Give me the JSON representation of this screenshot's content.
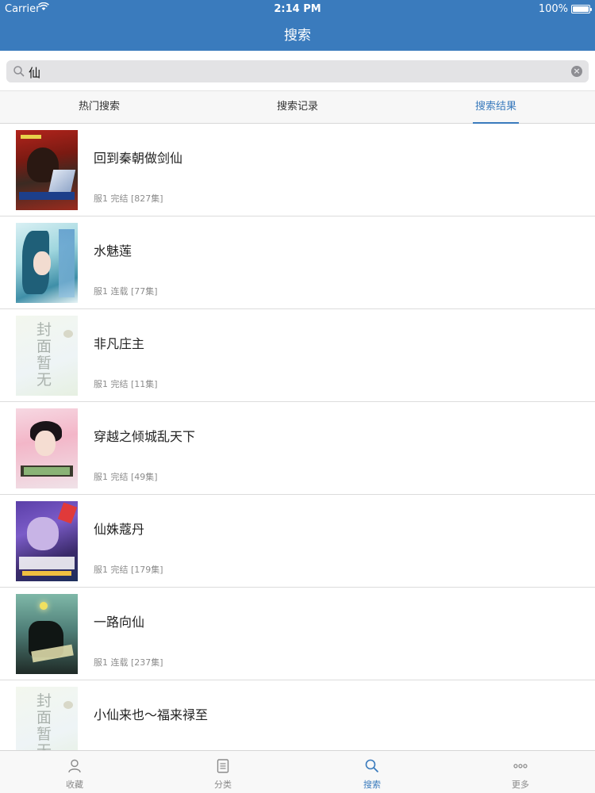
{
  "status": {
    "carrier": "Carrier",
    "time": "2:14 PM",
    "battery": "100%"
  },
  "nav": {
    "title": "搜索"
  },
  "search": {
    "query": "仙"
  },
  "tabs": [
    {
      "label": "热门搜索"
    },
    {
      "label": "搜索记录"
    },
    {
      "label": "搜索结果",
      "active": true
    }
  ],
  "results": [
    {
      "title": "回到秦朝做剑仙",
      "meta": "服1  完结 [827集]",
      "cover": "art"
    },
    {
      "title": "水魅莲",
      "meta": "服1  连载 [77集]",
      "cover": "art"
    },
    {
      "title": "非凡庄主",
      "meta": "服1  完结 [11集]",
      "cover": "placeholder",
      "placeholder_text": "封面暂无"
    },
    {
      "title": "穿越之倾城乱天下",
      "meta": "服1  完结 [49集]",
      "cover": "art"
    },
    {
      "title": "仙姝蔻丹",
      "meta": "服1  完结 [179集]",
      "cover": "art"
    },
    {
      "title": "一路向仙",
      "meta": "服1  连载 [237集]",
      "cover": "art"
    },
    {
      "title": "小仙来也～福来禄至",
      "meta": "",
      "cover": "placeholder",
      "placeholder_text": "封面暂无"
    }
  ],
  "tabbar": [
    {
      "label": "收藏",
      "icon": "person-icon"
    },
    {
      "label": "分类",
      "icon": "list-doc-icon"
    },
    {
      "label": "搜索",
      "icon": "search-icon",
      "active": true
    },
    {
      "label": "更多",
      "icon": "more-icon"
    }
  ],
  "colors": {
    "accent": "#3a7bbd",
    "header_bg": "#3a7bbd"
  }
}
